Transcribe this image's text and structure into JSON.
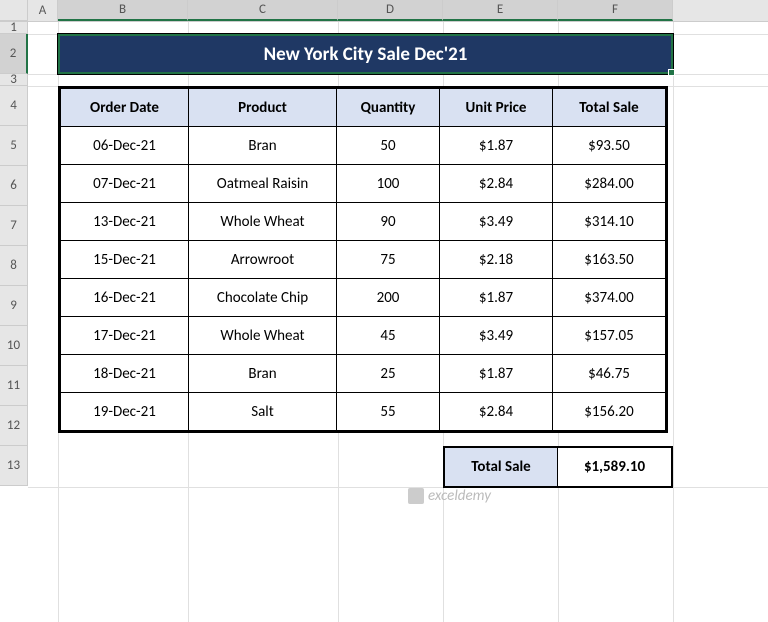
{
  "columns": [
    "A",
    "B",
    "C",
    "D",
    "E",
    "F"
  ],
  "rowCount": 13,
  "title": "New York City Sale Dec'21",
  "headers": {
    "order_date": "Order Date",
    "product": "Product",
    "quantity": "Quantity",
    "unit_price": "Unit Price",
    "total_sale": "Total Sale"
  },
  "rows": [
    {
      "date": "06-Dec-21",
      "product": "Bran",
      "qty": "50",
      "price": "$1.87",
      "total": "$93.50"
    },
    {
      "date": "07-Dec-21",
      "product": "Oatmeal Raisin",
      "qty": "100",
      "price": "$2.84",
      "total": "$284.00"
    },
    {
      "date": "13-Dec-21",
      "product": "Whole Wheat",
      "qty": "90",
      "price": "$3.49",
      "total": "$314.10"
    },
    {
      "date": "15-Dec-21",
      "product": "Arrowroot",
      "qty": "75",
      "price": "$2.18",
      "total": "$163.50"
    },
    {
      "date": "16-Dec-21",
      "product": "Chocolate Chip",
      "qty": "200",
      "price": "$1.87",
      "total": "$374.00"
    },
    {
      "date": "17-Dec-21",
      "product": "Whole Wheat",
      "qty": "45",
      "price": "$3.49",
      "total": "$157.05"
    },
    {
      "date": "18-Dec-21",
      "product": "Bran",
      "qty": "25",
      "price": "$1.87",
      "total": "$46.75"
    },
    {
      "date": "19-Dec-21",
      "product": "Salt",
      "qty": "55",
      "price": "$2.84",
      "total": "$156.20"
    }
  ],
  "total": {
    "label": "Total Sale",
    "value": "$1,589.10"
  },
  "watermark": "exceldemy",
  "chart_data": {
    "type": "table",
    "title": "New York City Sale Dec'21",
    "columns": [
      "Order Date",
      "Product",
      "Quantity",
      "Unit Price",
      "Total Sale"
    ],
    "data": [
      [
        "06-Dec-21",
        "Bran",
        50,
        1.87,
        93.5
      ],
      [
        "07-Dec-21",
        "Oatmeal Raisin",
        100,
        2.84,
        284.0
      ],
      [
        "13-Dec-21",
        "Whole Wheat",
        90,
        3.49,
        314.1
      ],
      [
        "15-Dec-21",
        "Arrowroot",
        75,
        2.18,
        163.5
      ],
      [
        "16-Dec-21",
        "Chocolate Chip",
        200,
        1.87,
        374.0
      ],
      [
        "17-Dec-21",
        "Whole Wheat",
        45,
        3.49,
        157.05
      ],
      [
        "18-Dec-21",
        "Bran",
        25,
        1.87,
        46.75
      ],
      [
        "19-Dec-21",
        "Salt",
        55,
        2.84,
        156.2
      ]
    ],
    "total_sale": 1589.1
  }
}
